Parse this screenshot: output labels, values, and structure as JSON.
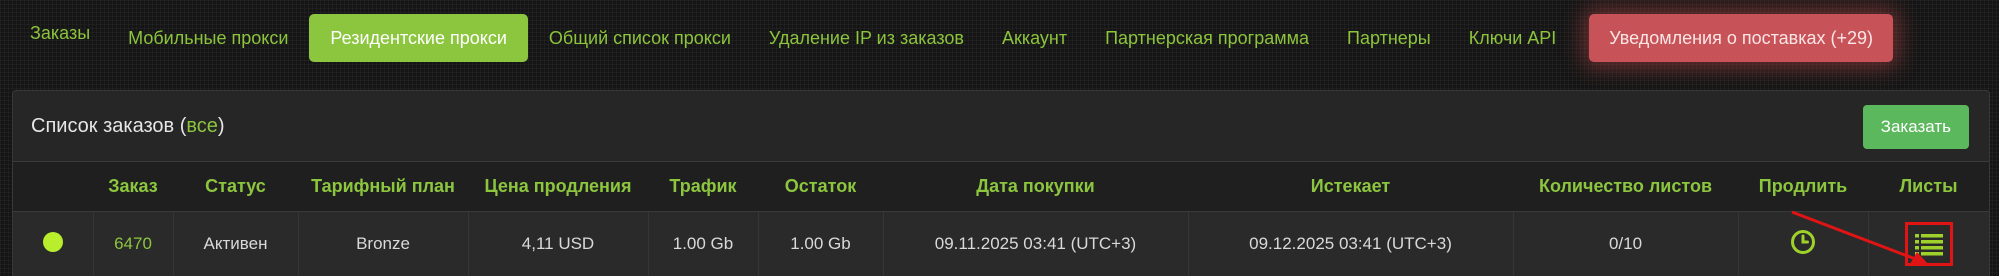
{
  "nav": {
    "items": [
      {
        "label": "Заказы"
      },
      {
        "label": "Мобильные прокси"
      },
      {
        "label": "Резидентские прокси"
      },
      {
        "label": "Общий список прокси"
      },
      {
        "label": "Удаление IP из заказов"
      },
      {
        "label": "Аккаунт"
      },
      {
        "label": "Партнерская программа"
      },
      {
        "label": "Партнеры"
      },
      {
        "label": "Ключи API"
      }
    ],
    "notifications_label": "Уведомления о поставках (+29)"
  },
  "panel": {
    "title": "Список заказов (",
    "all_link": "все",
    "title_close": ")",
    "order_button": "Заказать"
  },
  "table": {
    "headers": [
      "",
      "Заказ",
      "Статус",
      "Тарифный план",
      "Цена продления",
      "Трафик",
      "Остаток",
      "Дата покупки",
      "Истекает",
      "Количество листов",
      "Продлить",
      "Листы"
    ],
    "rows": [
      {
        "order": "6470",
        "status": "Активен",
        "plan": "Bronze",
        "renew_price": "4,11 USD",
        "traffic": "1.00 Gb",
        "remaining": "1.00 Gb",
        "purchase_date": "09.11.2025 03:41 (UTC+3)",
        "expires": "09.12.2025 03:41 (UTC+3)",
        "sheets_count": "0/10"
      }
    ]
  },
  "colors": {
    "accent": "#8cc63f",
    "status_dot": "#b9ee2d",
    "alert": "#c75359",
    "highlight_box": "#e01414"
  },
  "icons": {
    "renew": "clock-icon",
    "sheets": "list-icon",
    "annotation": "arrow-annotation"
  }
}
